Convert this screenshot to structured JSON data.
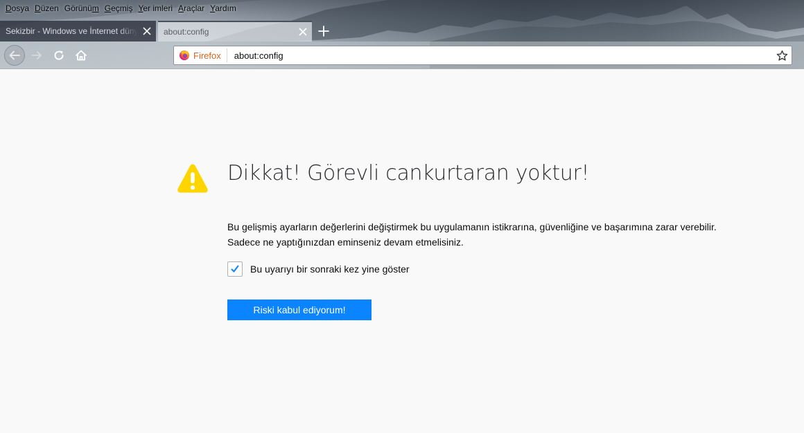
{
  "menubar": {
    "items": [
      {
        "pre": "",
        "u": "D",
        "post": "osya"
      },
      {
        "pre": "",
        "u": "D",
        "post": "üzen"
      },
      {
        "pre": "Görünü",
        "u": "m",
        "post": ""
      },
      {
        "pre": "",
        "u": "G",
        "post": "eçmiş"
      },
      {
        "pre": "",
        "u": "Y",
        "post": "er imleri"
      },
      {
        "pre": "",
        "u": "A",
        "post": "raçlar"
      },
      {
        "pre": "",
        "u": "Y",
        "post": "ardım"
      }
    ]
  },
  "tabs": [
    {
      "title": "Sekizbir - Windows ve İnternet dünyası",
      "active": false
    },
    {
      "title": "about:config",
      "active": true
    }
  ],
  "urlbar": {
    "identity_label": "Firefox",
    "url": "about:config"
  },
  "page": {
    "title": "Dikkat! Görevli cankurtaran yoktur!",
    "description_line1": "Bu gelişmiş ayarların değerlerini değiştirmek bu uygulamanın istikrarına, güvenliğine ve başarımına zarar verebilir.",
    "description_line2": "Sadece ne yaptığınızdan eminseniz devam etmelisiniz.",
    "checkbox_label": "Bu uyarıyı bir sonraki kez yine göster",
    "checkbox_checked": true,
    "accept_button": "Riski kabul ediyorum!"
  },
  "colors": {
    "accent": "#0a84ff",
    "warning": "#ffd500",
    "firefox_label": "#d7611b"
  },
  "icons": [
    "back-arrow-icon",
    "forward-arrow-icon",
    "reload-icon",
    "home-icon",
    "firefox-logo-icon",
    "bookmark-star-icon",
    "close-icon",
    "plus-icon",
    "warning-icon",
    "checkmark-icon"
  ]
}
